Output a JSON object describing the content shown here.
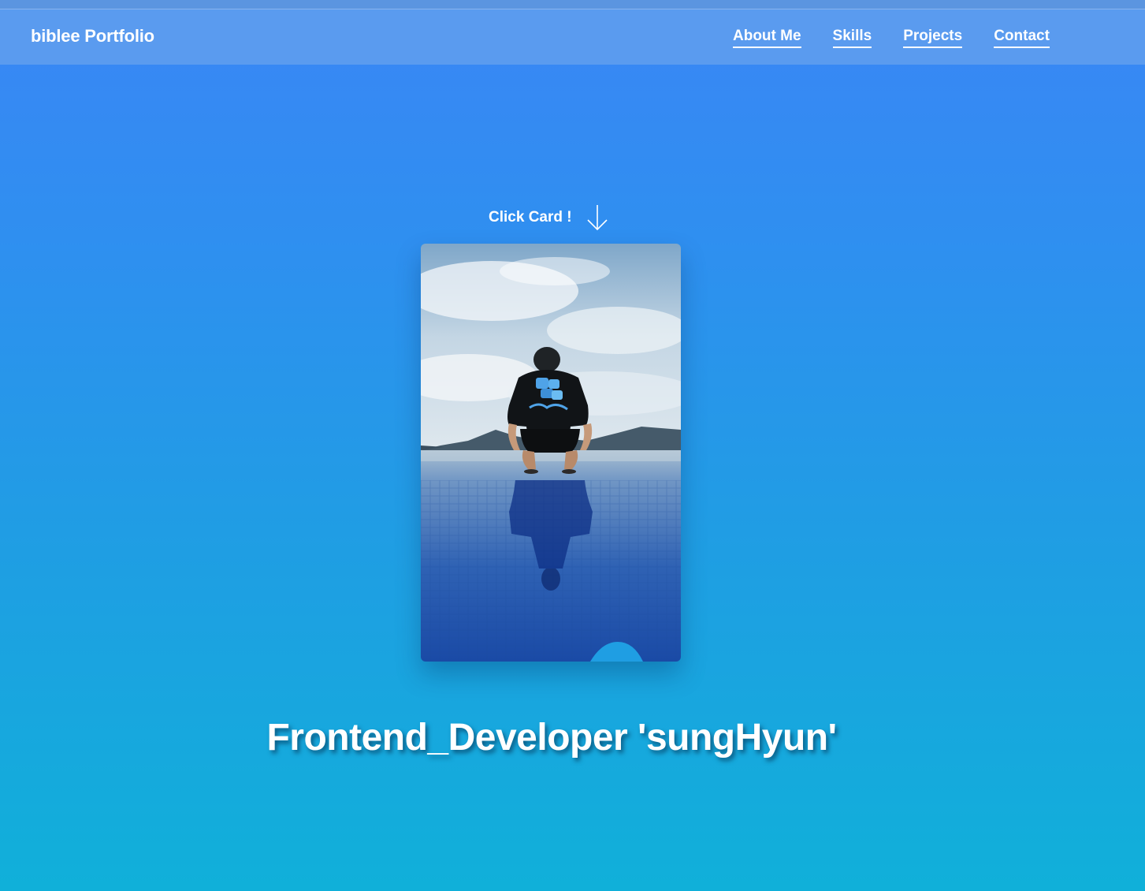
{
  "header": {
    "brand": "biblee Portfolio",
    "nav": [
      {
        "label": "About Me"
      },
      {
        "label": "Skills"
      },
      {
        "label": "Projects"
      },
      {
        "label": "Contact"
      }
    ]
  },
  "hero": {
    "hint_label": "Click Card !",
    "hint_icon": "arrow-down-icon",
    "card_image": "profile-photo",
    "tagline": "Frontend_Developer 'sungHyun'"
  },
  "colors": {
    "background_top": "#3a86f5",
    "background_bottom": "#10b0d9",
    "navbar": "#5a9bef",
    "text": "#ffffff"
  }
}
